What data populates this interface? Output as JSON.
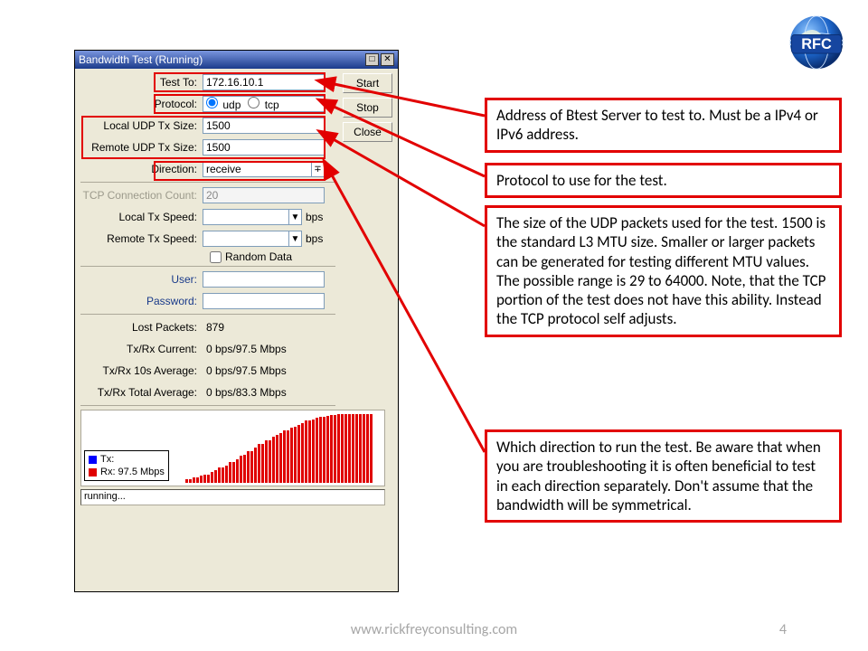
{
  "window": {
    "title": "Bandwidth Test (Running)",
    "fields": {
      "test_to": {
        "label": "Test To:",
        "value": "172.16.10.1"
      },
      "protocol": {
        "label": "Protocol:",
        "udp": "udp",
        "tcp": "tcp"
      },
      "local_udp": {
        "label": "Local UDP Tx Size:",
        "value": "1500"
      },
      "remote_udp": {
        "label": "Remote UDP Tx Size:",
        "value": "1500"
      },
      "direction": {
        "label": "Direction:",
        "value": "receive"
      },
      "tcp_conn": {
        "label": "TCP Connection Count:",
        "value": "20"
      },
      "local_tx": {
        "label": "Local Tx Speed:",
        "unit": "bps"
      },
      "remote_tx": {
        "label": "Remote Tx Speed:",
        "unit": "bps"
      },
      "random": "Random Data",
      "user": {
        "label": "User:"
      },
      "password": {
        "label": "Password:"
      },
      "lost": {
        "label": "Lost Packets:",
        "value": "879"
      },
      "cur": {
        "label": "Tx/Rx Current:",
        "value": "0 bps/97.5 Mbps"
      },
      "avg10": {
        "label": "Tx/Rx 10s Average:",
        "value": "0 bps/97.5 Mbps"
      },
      "avgTot": {
        "label": "Tx/Rx Total Average:",
        "value": "0 bps/83.3 Mbps"
      }
    },
    "buttons": {
      "start": "Start",
      "stop": "Stop",
      "close": "Close"
    },
    "legend": {
      "tx": "Tx:",
      "rx": "Rx:  97.5 Mbps"
    },
    "status": "running..."
  },
  "callouts": {
    "test_to": "Address of Btest Server to test to. Must be a IPv4 or IPv6 address.",
    "protocol": "Protocol to use for the test.",
    "udp_size": "The size of the UDP packets used for the test. 1500 is the standard L3 MTU size. Smaller or larger packets can be generated for testing different MTU values. The possible range is 29 to 64000. Note, that the TCP portion of the test does not have this ability. Instead the TCP protocol self adjusts.",
    "direction": "Which direction to run the test. Be aware that when you are troubleshooting it is often beneficial to test in each direction separately. Don't assume that the bandwidth will be symmetrical."
  },
  "footer": {
    "url": "www.rickfreyconsulting.com",
    "page": "4"
  },
  "logo_text": "RFC",
  "chart_data": {
    "type": "bar",
    "title": "",
    "xlabel": "",
    "ylabel": "",
    "ylim": [
      0,
      100
    ],
    "series": [
      {
        "name": "Tx",
        "color": "#0000ff",
        "values": []
      },
      {
        "name": "Rx",
        "color": "#e00000",
        "values": [
          5,
          5,
          8,
          8,
          10,
          12,
          12,
          15,
          18,
          22,
          22,
          25,
          30,
          30,
          33,
          38,
          40,
          45,
          45,
          50,
          55,
          55,
          60,
          60,
          65,
          68,
          70,
          75,
          75,
          78,
          80,
          82,
          85,
          88,
          88,
          90,
          92,
          93,
          94,
          95,
          96,
          96,
          97,
          97,
          97,
          97,
          97,
          97,
          97,
          97,
          97,
          97
        ]
      }
    ]
  }
}
